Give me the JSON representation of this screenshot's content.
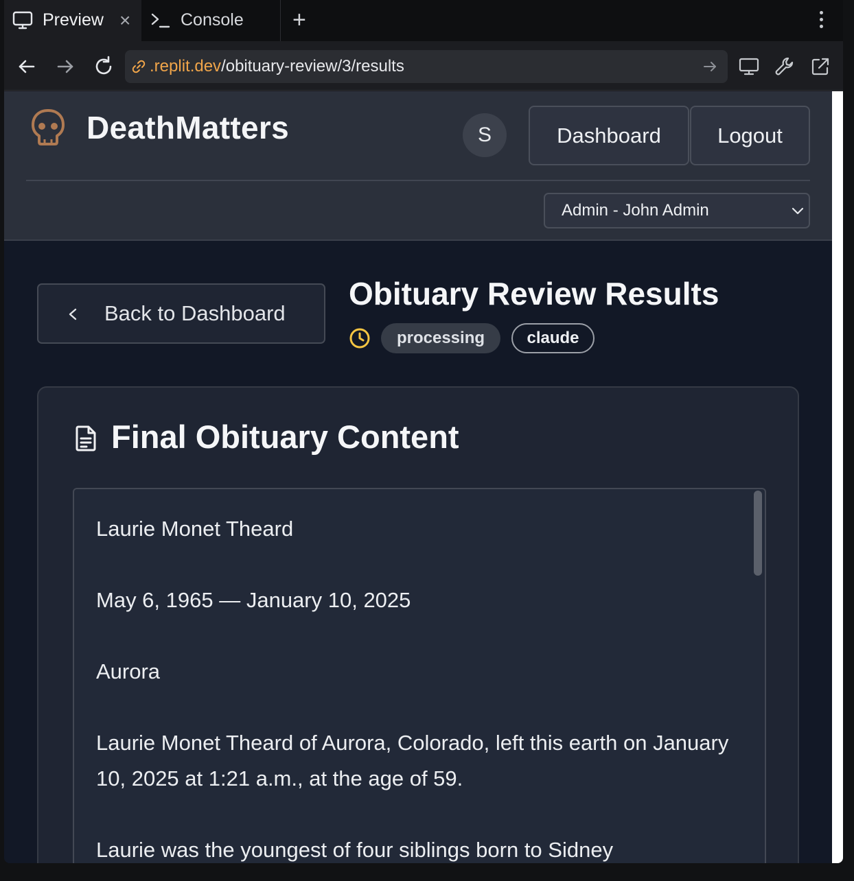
{
  "browser": {
    "tabs": [
      {
        "label": "Preview",
        "icon": "monitor-icon",
        "active": true
      },
      {
        "label": "Console",
        "icon": "terminal-icon",
        "active": false
      }
    ],
    "new_tab": "+",
    "close": "×",
    "url": {
      "prefix": ".replit.dev",
      "path": "/obituary-review/3/results"
    }
  },
  "app": {
    "brand": "DeathMatters",
    "avatar_initial": "S",
    "nav": {
      "dashboard": "Dashboard",
      "logout": "Logout"
    },
    "user_select": {
      "selected": "Admin - John Admin"
    },
    "back_button": "Back to Dashboard",
    "page_title": "Obituary Review Results",
    "status_badge": "processing",
    "model_badge": "claude",
    "card": {
      "title": "Final Obituary Content",
      "lines": [
        "Laurie Monet Theard",
        "May 6, 1965 — January 10, 2025",
        "Aurora",
        "Laurie Monet Theard of Aurora, Colorado, left this earth on January 10, 2025 at 1:21 a.m., at the age of 59.",
        "Laurie was the youngest of four siblings born to Sidney"
      ]
    }
  },
  "colors": {
    "accent_orange": "#f0a54a",
    "status_yellow": "#f5c542",
    "logo_bronze": "#b07a52",
    "app_bg": "#121826",
    "header_bg": "#2b303b"
  }
}
